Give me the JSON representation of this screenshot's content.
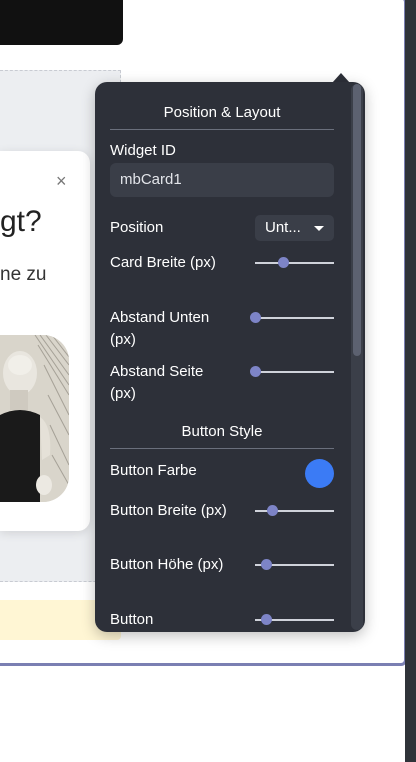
{
  "preview": {
    "close_symbol": "×",
    "question_fragment": "gt?",
    "subtitle_fragment": "ne zu"
  },
  "panel": {
    "section_layout_title": "Position & Layout",
    "widget_id_label": "Widget ID",
    "widget_id_value": "mbCard1",
    "position_label": "Position",
    "position_value": "Unt...",
    "card_width_label": "Card Breite (px)",
    "card_width_value": 0.35,
    "offset_bottom_label": "Abstand Unten (px)",
    "offset_bottom_value": 0.0,
    "offset_side_label": "Abstand Seite (px)",
    "offset_side_value": 0.0,
    "section_button_title": "Button Style",
    "button_color_label": "Button Farbe",
    "button_color_value": "#3b7bf5",
    "button_width_label": "Button Breite (px)",
    "button_width_value": 0.22,
    "button_height_label": "Button Höhe (px)",
    "button_height_value": 0.14,
    "button_last_label": "Button",
    "button_last_value": 0.14
  },
  "colors": {
    "panel_bg": "#2d3039",
    "accent_knob": "#7d84c7",
    "frame_border": "#7a7fb2"
  }
}
